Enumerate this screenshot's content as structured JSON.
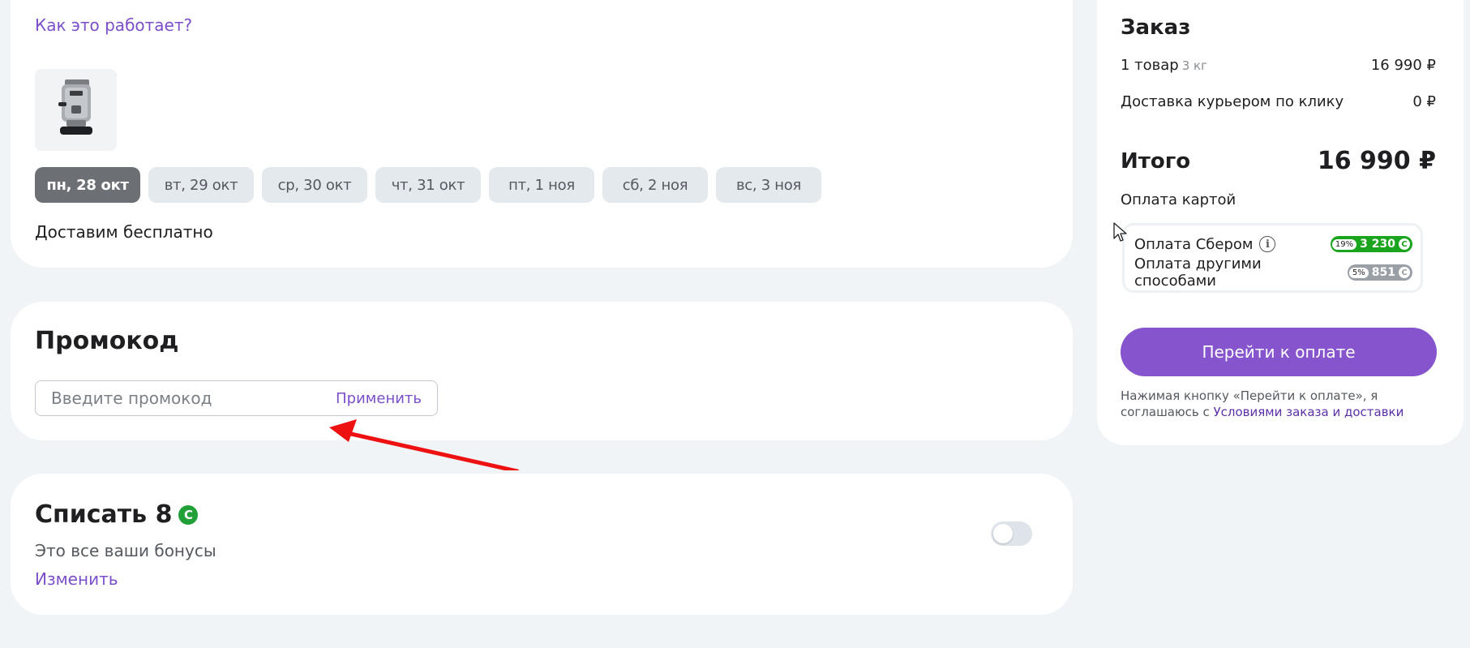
{
  "delivery": {
    "how_it_works": "Как это работает?",
    "product_image": "coffee-machine",
    "dates": [
      {
        "label": "пн, 28 окт",
        "selected": true
      },
      {
        "label": "вт, 29 окт",
        "selected": false
      },
      {
        "label": "ср, 30 окт",
        "selected": false
      },
      {
        "label": "чт, 31 окт",
        "selected": false
      },
      {
        "label": "пт, 1 ноя",
        "selected": false
      },
      {
        "label": "сб, 2 ноя",
        "selected": false
      },
      {
        "label": "вс, 3 ноя",
        "selected": false
      }
    ],
    "free_delivery_text": "Доставим бесплатно"
  },
  "promo": {
    "title": "Промокод",
    "placeholder": "Введите промокод",
    "value": "",
    "apply_label": "Применить"
  },
  "bonus": {
    "title": "Списать 8",
    "coin_icon": "sber-spasibo-icon",
    "subtitle": "Это все ваши бонусы",
    "change_label": "Изменить",
    "toggle_on": false
  },
  "order": {
    "title": "Заказ",
    "items_label": "1 товар",
    "items_weight": "3 кг",
    "items_price": "16 990 ₽",
    "delivery_label": "Доставка курьером по клику",
    "delivery_price": "0 ₽",
    "total_label": "Итого",
    "total_price": "16 990 ₽",
    "payment_label": "Оплата картой",
    "payment_options": [
      {
        "label": "Оплата Сбером",
        "percent": "19%",
        "bonus": "3 230",
        "color": "#1ba41d",
        "has_info": true
      },
      {
        "label": "Оплата другими способами",
        "percent": "5%",
        "bonus": "851",
        "color": "#9aa0a6",
        "has_info": false
      }
    ],
    "checkout_label": "Перейти к оплате",
    "agreement_text": "Нажимая кнопку «Перейти к оплате», я соглашаюсь с",
    "agreement_link": "Условиями заказа и доставки"
  },
  "colors": {
    "accent": "#8654cc",
    "link": "#7b4fc9",
    "page_bg": "#f1f4f7",
    "annotation_arrow": "#ee1111"
  }
}
